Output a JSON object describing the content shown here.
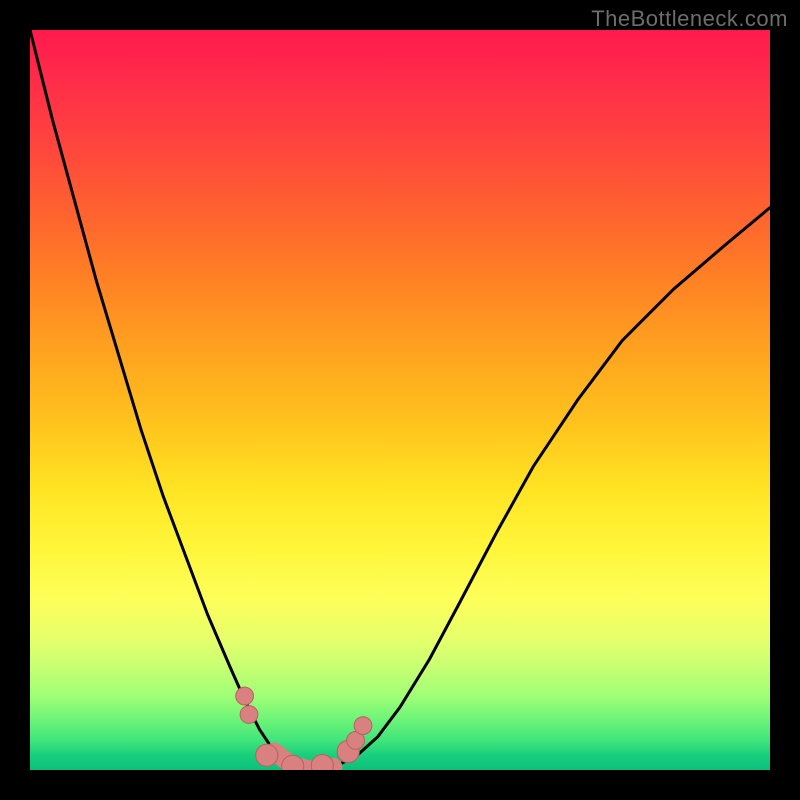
{
  "watermark": "TheBottleneck.com",
  "colors": {
    "background": "#000000",
    "curve_stroke": "#000000",
    "marker_fill": "#d98080",
    "marker_stroke": "#bc5e5e"
  },
  "chart_data": {
    "type": "line",
    "title": "",
    "xlabel": "",
    "ylabel": "",
    "xlim": [
      0,
      1
    ],
    "ylim": [
      0,
      1
    ],
    "grid": false,
    "series": [
      {
        "name": "bottleneck-curve",
        "x": [
          0.0,
          0.03,
          0.06,
          0.09,
          0.12,
          0.15,
          0.18,
          0.21,
          0.24,
          0.27,
          0.29,
          0.31,
          0.33,
          0.353,
          0.38,
          0.41,
          0.44,
          0.47,
          0.5,
          0.54,
          0.58,
          0.63,
          0.68,
          0.74,
          0.8,
          0.87,
          0.94,
          1.0
        ],
        "y": [
          1.0,
          0.88,
          0.77,
          0.66,
          0.56,
          0.46,
          0.37,
          0.29,
          0.21,
          0.14,
          0.095,
          0.055,
          0.025,
          0.007,
          0.0,
          0.004,
          0.018,
          0.045,
          0.085,
          0.15,
          0.225,
          0.32,
          0.41,
          0.5,
          0.58,
          0.65,
          0.71,
          0.76
        ]
      }
    ],
    "markers": {
      "name": "highlight-points",
      "x": [
        0.29,
        0.296,
        0.32,
        0.355,
        0.395,
        0.43,
        0.44,
        0.45
      ],
      "y": [
        0.1,
        0.075,
        0.02,
        0.005,
        0.006,
        0.025,
        0.04,
        0.06
      ],
      "r": [
        0.012,
        0.012,
        0.015,
        0.015,
        0.015,
        0.015,
        0.012,
        0.012
      ]
    }
  }
}
